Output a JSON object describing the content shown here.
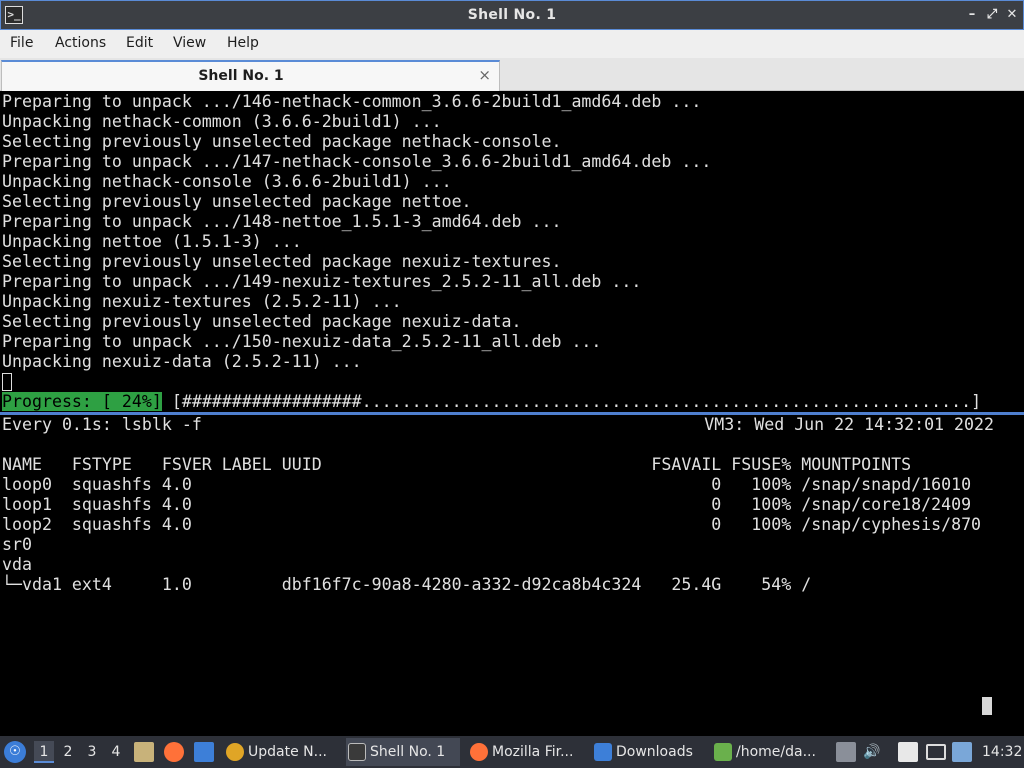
{
  "window": {
    "title": "Shell No. 1",
    "app_icon_text": ">_",
    "minimize_glyph": "–",
    "restore_glyph": "⤢",
    "close_glyph": "✕"
  },
  "menu": {
    "file": "File",
    "actions": "Actions",
    "edit": "Edit",
    "view": "View",
    "help": "Help"
  },
  "tab": {
    "label": "Shell No. 1",
    "close_glyph": "×"
  },
  "terminal_top": {
    "lines": [
      "Preparing to unpack .../146-nethack-common_3.6.6-2build1_amd64.deb ...",
      "Unpacking nethack-common (3.6.6-2build1) ...",
      "Selecting previously unselected package nethack-console.",
      "Preparing to unpack .../147-nethack-console_3.6.6-2build1_amd64.deb ...",
      "Unpacking nethack-console (3.6.6-2build1) ...",
      "Selecting previously unselected package nettoe.",
      "Preparing to unpack .../148-nettoe_1.5.1-3_amd64.deb ...",
      "Unpacking nettoe (1.5.1-3) ...",
      "Selecting previously unselected package nexuiz-textures.",
      "Preparing to unpack .../149-nexuiz-textures_2.5.2-11_all.deb ...",
      "Unpacking nexuiz-textures (2.5.2-11) ...",
      "Selecting previously unselected package nexuiz-data.",
      "Preparing to unpack .../150-nexuiz-data_2.5.2-11_all.deb ...",
      "Unpacking nexuiz-data (2.5.2-11) ..."
    ],
    "progress_label": "Progress: [ 24%]",
    "progress_bar": " [##################.............................................................]",
    "progress_fraction": 0.24
  },
  "terminal_bottom": {
    "watch_cmd": "Every 0.1s: lsblk -f",
    "watch_status": "VM3: Wed Jun 22 14:32:01 2022",
    "rows": [
      "NAME   FSTYPE   FSVER LABEL UUID                                 FSAVAIL FSUSE% MOUNTPOINTS",
      "loop0  squashfs 4.0                                                    0   100% /snap/snapd/16010",
      "loop1  squashfs 4.0                                                    0   100% /snap/core18/2409",
      "loop2  squashfs 4.0                                                    0   100% /snap/cyphesis/870",
      "sr0",
      "vda",
      "└─vda1 ext4     1.0         dbf16f7c-90a8-4280-a332-d92ca8b4c324   25.4G    54% /"
    ]
  },
  "taskbar": {
    "workspaces": [
      "1",
      "2",
      "3",
      "4"
    ],
    "tasks": [
      {
        "label": "Update N...",
        "icon_color": "#e0a526"
      },
      {
        "label": "Shell No. 1",
        "icon_color": "#3a3a3a"
      },
      {
        "label": "Mozilla Fir...",
        "icon_color": "#ff7139"
      },
      {
        "label": "Downloads",
        "icon_color": "#3d7fd8"
      },
      {
        "label": "/home/da...",
        "icon_color": "#6ab04c"
      }
    ],
    "clock": "14:32"
  }
}
